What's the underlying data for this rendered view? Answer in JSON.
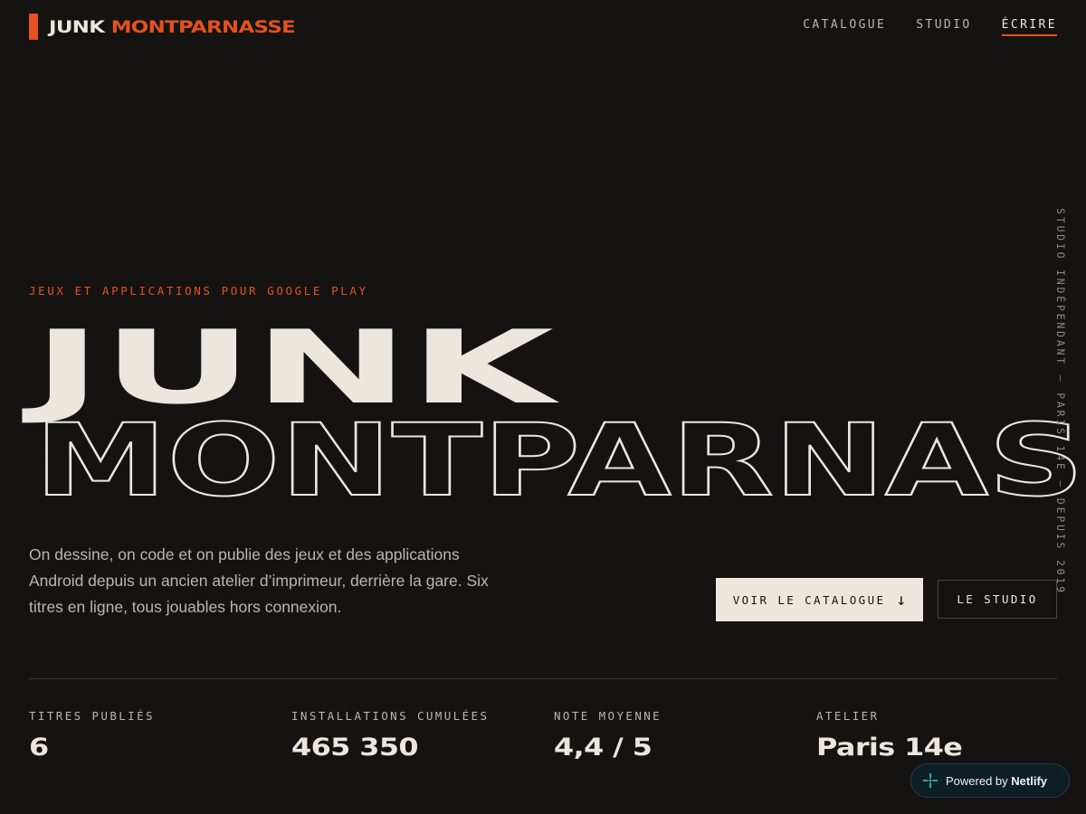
{
  "brand": {
    "word1": "JUNK",
    "word2": "MONTPARNASSE",
    "accent_color": "#e5511f"
  },
  "nav": {
    "items": [
      {
        "label": "CATALOGUE",
        "active": false
      },
      {
        "label": "STUDIO",
        "active": false
      },
      {
        "label": "ÉCRIRE",
        "active": true
      }
    ]
  },
  "hero": {
    "eyebrow": "JEUX ET APPLICATIONS POUR GOOGLE PLAY",
    "title_line1": "JUNK",
    "title_line2": "MONTPARNASSE",
    "lede": "On dessine, on code et on publie des jeux et des applications Android depuis un ancien atelier d’imprimeur, derrière la gare. Six titres en ligne, tous jouables hors connexion.",
    "cta_primary": "VOIR LE CATALOGUE",
    "cta_primary_icon": "arrow-down-icon",
    "cta_secondary": "LE STUDIO",
    "vertical_tag": "STUDIO INDÉPENDANT — PARIS 14E — DEPUIS 2019"
  },
  "stats": [
    {
      "label": "TITRES PUBLIÉS",
      "value": "6"
    },
    {
      "label": "INSTALLATIONS CUMULÉES",
      "value": "465 350"
    },
    {
      "label": "NOTE MOYENNE",
      "value": "4,4 / 5"
    },
    {
      "label": "ATELIER",
      "value": "Paris 14e"
    }
  ],
  "badge": {
    "prefix": "Powered by",
    "brand": "Netlify",
    "icon": "netlify-icon"
  },
  "colors": {
    "background": "#151312",
    "foreground": "#ede6dc",
    "accent": "#e5511f",
    "muted": "#bdb5aa"
  }
}
